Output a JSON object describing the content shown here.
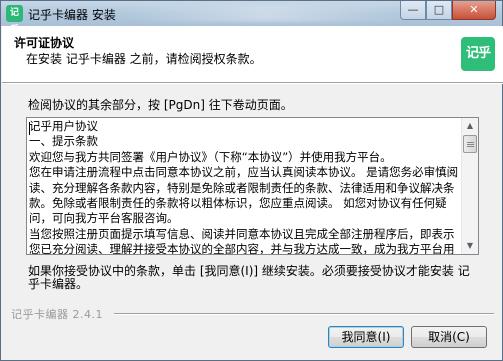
{
  "window": {
    "title": "记乎卡编器 安装",
    "app_icon_text": "记乎",
    "controls": {
      "minimize": "—",
      "maximize": "□",
      "close": "✕"
    }
  },
  "header": {
    "title": "许可证协议",
    "subtitle": "在安装 记乎卡编器 之前，请检阅授权条款。",
    "logo_text": "记乎"
  },
  "instruction": "检阅协议的其余部分，按 [PgDn] 往下卷动页面。",
  "license": {
    "text": "记乎用户协议\n一、提示条款\n欢迎您与我方共同签署《用户协议》（下称“本协议”）并使用我方平台。\n您在申请注册流程中点击同意本协议之前，应当认真阅读本协议。 是请您务必审慎阅读、充分理解各条款内容，特别是免除或者限制责任的条款、法律适用和争议解决条款。免除或者限制责任的条款将以粗体标识，您应重点阅读。 如您对协议有任何疑问，可向我方平台客服咨询。\n当您按照注册页面提示填写信息、阅读并同意本协议且完成全部注册程序后，即表示您已充分阅读、理解并接受本协议的全部内容，并与我方达成一致，成为我方平台用户。"
  },
  "accept_text": "如果你接受协议中的条款，单击 [我同意(I)] 继续安装。必须要接受协议才能安装 记乎卡编器。",
  "footer": {
    "brand": "记乎卡编器 2.4.1"
  },
  "buttons": {
    "agree": "我同意(I)",
    "cancel": "取消(C)"
  },
  "scrollbar": {
    "up_arrow": "▲",
    "down_arrow": "▼"
  }
}
